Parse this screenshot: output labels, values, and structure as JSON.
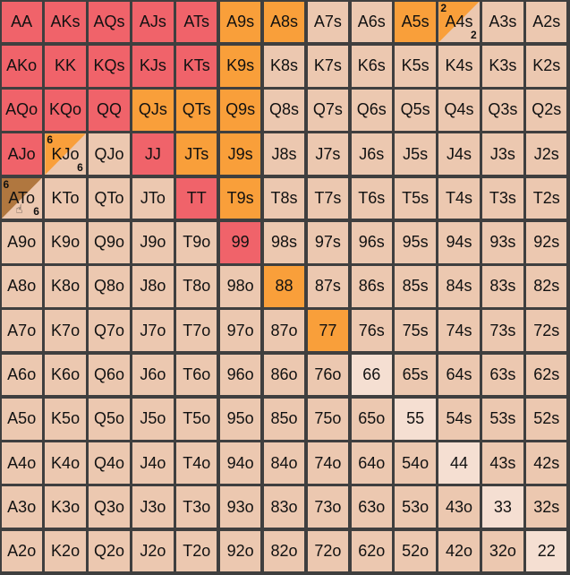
{
  "colors": {
    "red": "#f0636a",
    "orange": "#f99f3a",
    "light": "#ecc8b0",
    "pale": "#f5dfd2",
    "brown": "#b0773f"
  },
  "cursor_icon": "hand-pointer-icon",
  "rows": [
    [
      {
        "label": "AA",
        "color": "red"
      },
      {
        "label": "AKs",
        "color": "red"
      },
      {
        "label": "AQs",
        "color": "red"
      },
      {
        "label": "AJs",
        "color": "red"
      },
      {
        "label": "ATs",
        "color": "red"
      },
      {
        "label": "A9s",
        "color": "orange"
      },
      {
        "label": "A8s",
        "color": "orange"
      },
      {
        "label": "A7s",
        "color": "light"
      },
      {
        "label": "A6s",
        "color": "light"
      },
      {
        "label": "A5s",
        "color": "orange"
      },
      {
        "label": "A4s",
        "color": "split",
        "split_top": "orange",
        "split_bottom": "light",
        "tl": "2",
        "br": "2"
      },
      {
        "label": "A3s",
        "color": "light"
      },
      {
        "label": "A2s",
        "color": "light"
      }
    ],
    [
      {
        "label": "AKo",
        "color": "red"
      },
      {
        "label": "KK",
        "color": "red"
      },
      {
        "label": "KQs",
        "color": "red"
      },
      {
        "label": "KJs",
        "color": "red"
      },
      {
        "label": "KTs",
        "color": "red"
      },
      {
        "label": "K9s",
        "color": "orange"
      },
      {
        "label": "K8s",
        "color": "light"
      },
      {
        "label": "K7s",
        "color": "light"
      },
      {
        "label": "K6s",
        "color": "light"
      },
      {
        "label": "K5s",
        "color": "light"
      },
      {
        "label": "K4s",
        "color": "light"
      },
      {
        "label": "K3s",
        "color": "light"
      },
      {
        "label": "K2s",
        "color": "light"
      }
    ],
    [
      {
        "label": "AQo",
        "color": "red"
      },
      {
        "label": "KQo",
        "color": "red"
      },
      {
        "label": "QQ",
        "color": "red"
      },
      {
        "label": "QJs",
        "color": "orange"
      },
      {
        "label": "QTs",
        "color": "orange"
      },
      {
        "label": "Q9s",
        "color": "orange"
      },
      {
        "label": "Q8s",
        "color": "light"
      },
      {
        "label": "Q7s",
        "color": "light"
      },
      {
        "label": "Q6s",
        "color": "light"
      },
      {
        "label": "Q5s",
        "color": "light"
      },
      {
        "label": "Q4s",
        "color": "light"
      },
      {
        "label": "Q3s",
        "color": "light"
      },
      {
        "label": "Q2s",
        "color": "light"
      }
    ],
    [
      {
        "label": "AJo",
        "color": "red"
      },
      {
        "label": "KJo",
        "color": "split",
        "split_top": "orange",
        "split_bottom": "light",
        "tl": "6",
        "br": "6"
      },
      {
        "label": "QJo",
        "color": "light"
      },
      {
        "label": "JJ",
        "color": "red"
      },
      {
        "label": "JTs",
        "color": "orange"
      },
      {
        "label": "J9s",
        "color": "orange"
      },
      {
        "label": "J8s",
        "color": "light"
      },
      {
        "label": "J7s",
        "color": "light"
      },
      {
        "label": "J6s",
        "color": "light"
      },
      {
        "label": "J5s",
        "color": "light"
      },
      {
        "label": "J4s",
        "color": "light"
      },
      {
        "label": "J3s",
        "color": "light"
      },
      {
        "label": "J2s",
        "color": "light"
      }
    ],
    [
      {
        "label": "ATo",
        "color": "split",
        "split_top": "brown",
        "split_bottom": "light",
        "tl": "6",
        "br": "6",
        "cursor": true
      },
      {
        "label": "KTo",
        "color": "light"
      },
      {
        "label": "QTo",
        "color": "light"
      },
      {
        "label": "JTo",
        "color": "light"
      },
      {
        "label": "TT",
        "color": "red"
      },
      {
        "label": "T9s",
        "color": "orange"
      },
      {
        "label": "T8s",
        "color": "light"
      },
      {
        "label": "T7s",
        "color": "light"
      },
      {
        "label": "T6s",
        "color": "light"
      },
      {
        "label": "T5s",
        "color": "light"
      },
      {
        "label": "T4s",
        "color": "light"
      },
      {
        "label": "T3s",
        "color": "light"
      },
      {
        "label": "T2s",
        "color": "light"
      }
    ],
    [
      {
        "label": "A9o",
        "color": "light"
      },
      {
        "label": "K9o",
        "color": "light"
      },
      {
        "label": "Q9o",
        "color": "light"
      },
      {
        "label": "J9o",
        "color": "light"
      },
      {
        "label": "T9o",
        "color": "light"
      },
      {
        "label": "99",
        "color": "red"
      },
      {
        "label": "98s",
        "color": "light"
      },
      {
        "label": "97s",
        "color": "light"
      },
      {
        "label": "96s",
        "color": "light"
      },
      {
        "label": "95s",
        "color": "light"
      },
      {
        "label": "94s",
        "color": "light"
      },
      {
        "label": "93s",
        "color": "light"
      },
      {
        "label": "92s",
        "color": "light"
      }
    ],
    [
      {
        "label": "A8o",
        "color": "light"
      },
      {
        "label": "K8o",
        "color": "light"
      },
      {
        "label": "Q8o",
        "color": "light"
      },
      {
        "label": "J8o",
        "color": "light"
      },
      {
        "label": "T8o",
        "color": "light"
      },
      {
        "label": "98o",
        "color": "light"
      },
      {
        "label": "88",
        "color": "orange"
      },
      {
        "label": "87s",
        "color": "light"
      },
      {
        "label": "86s",
        "color": "light"
      },
      {
        "label": "85s",
        "color": "light"
      },
      {
        "label": "84s",
        "color": "light"
      },
      {
        "label": "83s",
        "color": "light"
      },
      {
        "label": "82s",
        "color": "light"
      }
    ],
    [
      {
        "label": "A7o",
        "color": "light"
      },
      {
        "label": "K7o",
        "color": "light"
      },
      {
        "label": "Q7o",
        "color": "light"
      },
      {
        "label": "J7o",
        "color": "light"
      },
      {
        "label": "T7o",
        "color": "light"
      },
      {
        "label": "97o",
        "color": "light"
      },
      {
        "label": "87o",
        "color": "light"
      },
      {
        "label": "77",
        "color": "orange"
      },
      {
        "label": "76s",
        "color": "light"
      },
      {
        "label": "75s",
        "color": "light"
      },
      {
        "label": "74s",
        "color": "light"
      },
      {
        "label": "73s",
        "color": "light"
      },
      {
        "label": "72s",
        "color": "light"
      }
    ],
    [
      {
        "label": "A6o",
        "color": "light"
      },
      {
        "label": "K6o",
        "color": "light"
      },
      {
        "label": "Q6o",
        "color": "light"
      },
      {
        "label": "J6o",
        "color": "light"
      },
      {
        "label": "T6o",
        "color": "light"
      },
      {
        "label": "96o",
        "color": "light"
      },
      {
        "label": "86o",
        "color": "light"
      },
      {
        "label": "76o",
        "color": "light"
      },
      {
        "label": "66",
        "color": "pale"
      },
      {
        "label": "65s",
        "color": "light"
      },
      {
        "label": "64s",
        "color": "light"
      },
      {
        "label": "63s",
        "color": "light"
      },
      {
        "label": "62s",
        "color": "light"
      }
    ],
    [
      {
        "label": "A5o",
        "color": "light"
      },
      {
        "label": "K5o",
        "color": "light"
      },
      {
        "label": "Q5o",
        "color": "light"
      },
      {
        "label": "J5o",
        "color": "light"
      },
      {
        "label": "T5o",
        "color": "light"
      },
      {
        "label": "95o",
        "color": "light"
      },
      {
        "label": "85o",
        "color": "light"
      },
      {
        "label": "75o",
        "color": "light"
      },
      {
        "label": "65o",
        "color": "light"
      },
      {
        "label": "55",
        "color": "pale"
      },
      {
        "label": "54s",
        "color": "light"
      },
      {
        "label": "53s",
        "color": "light"
      },
      {
        "label": "52s",
        "color": "light"
      }
    ],
    [
      {
        "label": "A4o",
        "color": "light"
      },
      {
        "label": "K4o",
        "color": "light"
      },
      {
        "label": "Q4o",
        "color": "light"
      },
      {
        "label": "J4o",
        "color": "light"
      },
      {
        "label": "T4o",
        "color": "light"
      },
      {
        "label": "94o",
        "color": "light"
      },
      {
        "label": "84o",
        "color": "light"
      },
      {
        "label": "74o",
        "color": "light"
      },
      {
        "label": "64o",
        "color": "light"
      },
      {
        "label": "54o",
        "color": "light"
      },
      {
        "label": "44",
        "color": "pale"
      },
      {
        "label": "43s",
        "color": "light"
      },
      {
        "label": "42s",
        "color": "light"
      }
    ],
    [
      {
        "label": "A3o",
        "color": "light"
      },
      {
        "label": "K3o",
        "color": "light"
      },
      {
        "label": "Q3o",
        "color": "light"
      },
      {
        "label": "J3o",
        "color": "light"
      },
      {
        "label": "T3o",
        "color": "light"
      },
      {
        "label": "93o",
        "color": "light"
      },
      {
        "label": "83o",
        "color": "light"
      },
      {
        "label": "73o",
        "color": "light"
      },
      {
        "label": "63o",
        "color": "light"
      },
      {
        "label": "53o",
        "color": "light"
      },
      {
        "label": "43o",
        "color": "light"
      },
      {
        "label": "33",
        "color": "pale"
      },
      {
        "label": "32s",
        "color": "light"
      }
    ],
    [
      {
        "label": "A2o",
        "color": "light"
      },
      {
        "label": "K2o",
        "color": "light"
      },
      {
        "label": "Q2o",
        "color": "light"
      },
      {
        "label": "J2o",
        "color": "light"
      },
      {
        "label": "T2o",
        "color": "light"
      },
      {
        "label": "92o",
        "color": "light"
      },
      {
        "label": "82o",
        "color": "light"
      },
      {
        "label": "72o",
        "color": "light"
      },
      {
        "label": "62o",
        "color": "light"
      },
      {
        "label": "52o",
        "color": "light"
      },
      {
        "label": "42o",
        "color": "light"
      },
      {
        "label": "32o",
        "color": "light"
      },
      {
        "label": "22",
        "color": "pale"
      }
    ]
  ]
}
